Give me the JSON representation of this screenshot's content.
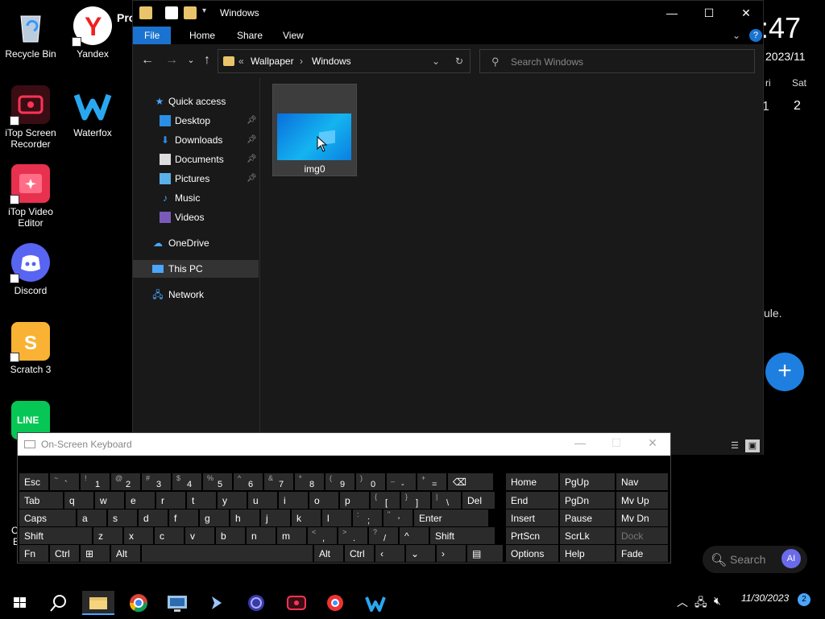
{
  "desktop": {
    "icons": [
      {
        "label": "Recycle Bin",
        "icon": "recycle-bin-icon"
      },
      {
        "label": "Yandex",
        "icon": "yandex-icon"
      },
      {
        "label": "Pro",
        "icon": "partial-icon"
      },
      {
        "label": "iTop Screen Recorder",
        "icon": "screen-recorder-icon"
      },
      {
        "label": "Waterfox",
        "icon": "waterfox-icon"
      },
      {
        "label": "iTop Video Editor",
        "icon": "video-editor-icon"
      },
      {
        "label": "Discord",
        "icon": "discord-icon"
      },
      {
        "label": "Scratch 3",
        "icon": "scratch-icon"
      },
      {
        "label": "LINE",
        "icon": "line-icon"
      }
    ],
    "partial_labels": {
      "c": "C",
      "e": "E"
    }
  },
  "widget": {
    "time": ":47",
    "date": "2023/11",
    "day_fri": "ri",
    "day_sat": "Sat",
    "num_1": "1",
    "num_2": "2",
    "text": "ule.",
    "add": "+",
    "search_label": "Search",
    "ai_label": "AI"
  },
  "explorer": {
    "title": "Windows",
    "ribbon_tabs": [
      "File",
      "Home",
      "Share",
      "View"
    ],
    "breadcrumb": {
      "overflow": "«",
      "segments": [
        "Wallpaper",
        "Windows"
      ],
      "separator": "›"
    },
    "search_placeholder": "Search Windows",
    "nav": {
      "quick_access": "Quick access",
      "items": [
        {
          "label": "Desktop",
          "pinned": true
        },
        {
          "label": "Downloads",
          "pinned": true
        },
        {
          "label": "Documents",
          "pinned": true
        },
        {
          "label": "Pictures",
          "pinned": true
        },
        {
          "label": "Music",
          "pinned": false
        },
        {
          "label": "Videos",
          "pinned": false
        }
      ],
      "onedrive": "OneDrive",
      "thispc": "This PC",
      "network": "Network"
    },
    "files": [
      {
        "name": "img0"
      }
    ]
  },
  "osk": {
    "title": "On-Screen Keyboard",
    "rows": [
      [
        [
          "Esc",
          ""
        ],
        [
          "`",
          "~"
        ],
        [
          "1",
          "!"
        ],
        [
          "2",
          "@"
        ],
        [
          "3",
          "#"
        ],
        [
          "4",
          "$"
        ],
        [
          "5",
          "%"
        ],
        [
          "6",
          "^"
        ],
        [
          "7",
          "&"
        ],
        [
          "8",
          "*"
        ],
        [
          "9",
          "("
        ],
        [
          "0",
          ")"
        ],
        [
          "-",
          "_"
        ],
        [
          "=",
          "+"
        ],
        [
          "⌫",
          ""
        ]
      ],
      [
        [
          "Tab",
          ""
        ],
        [
          "q",
          ""
        ],
        [
          "w",
          ""
        ],
        [
          "e",
          ""
        ],
        [
          "r",
          ""
        ],
        [
          "t",
          ""
        ],
        [
          "y",
          ""
        ],
        [
          "u",
          ""
        ],
        [
          "i",
          ""
        ],
        [
          "o",
          ""
        ],
        [
          "p",
          ""
        ],
        [
          "[",
          "{"
        ],
        [
          "]",
          "}"
        ],
        [
          "\\",
          "|"
        ],
        [
          "Del",
          ""
        ]
      ],
      [
        [
          "Caps",
          ""
        ],
        [
          "a",
          ""
        ],
        [
          "s",
          ""
        ],
        [
          "d",
          ""
        ],
        [
          "f",
          ""
        ],
        [
          "g",
          ""
        ],
        [
          "h",
          ""
        ],
        [
          "j",
          ""
        ],
        [
          "k",
          ""
        ],
        [
          "l",
          ""
        ],
        [
          ";",
          ":"
        ],
        [
          "'",
          "\""
        ],
        [
          "Enter",
          ""
        ]
      ],
      [
        [
          "Shift",
          ""
        ],
        [
          "z",
          ""
        ],
        [
          "x",
          ""
        ],
        [
          "c",
          ""
        ],
        [
          "v",
          ""
        ],
        [
          "b",
          ""
        ],
        [
          "n",
          ""
        ],
        [
          "m",
          ""
        ],
        [
          ",",
          "<"
        ],
        [
          ".",
          ">"
        ],
        [
          "/",
          "?"
        ],
        [
          "^",
          ""
        ],
        [
          "Shift",
          ""
        ]
      ],
      [
        [
          "Fn",
          ""
        ],
        [
          "Ctrl",
          ""
        ],
        [
          "⊞",
          ""
        ],
        [
          "Alt",
          ""
        ],
        [
          "",
          ""
        ],
        [
          "Alt",
          ""
        ],
        [
          "Ctrl",
          ""
        ],
        [
          "‹",
          ""
        ],
        [
          "⌄",
          ""
        ],
        [
          "›",
          ""
        ],
        [
          "▤",
          ""
        ]
      ]
    ],
    "nav_keys": [
      [
        "Home",
        "PgUp",
        "Nav"
      ],
      [
        "End",
        "PgDn",
        "Mv Up"
      ],
      [
        "Insert",
        "Pause",
        "Mv Dn"
      ],
      [
        "PrtScn",
        "ScrLk",
        "Dock"
      ],
      [
        "Options",
        "Help",
        "Fade"
      ]
    ]
  },
  "taskbar": {
    "apps": [
      "start-icon",
      "search-icon",
      "file-explorer-icon",
      "chrome-icon",
      "remote-desktop-icon",
      "pointer-icon",
      "app-icon",
      "screen-recorder-icon",
      "chrome-old-icon",
      "waterfox-icon"
    ],
    "date": "11/30/2023",
    "notifications": "2"
  }
}
